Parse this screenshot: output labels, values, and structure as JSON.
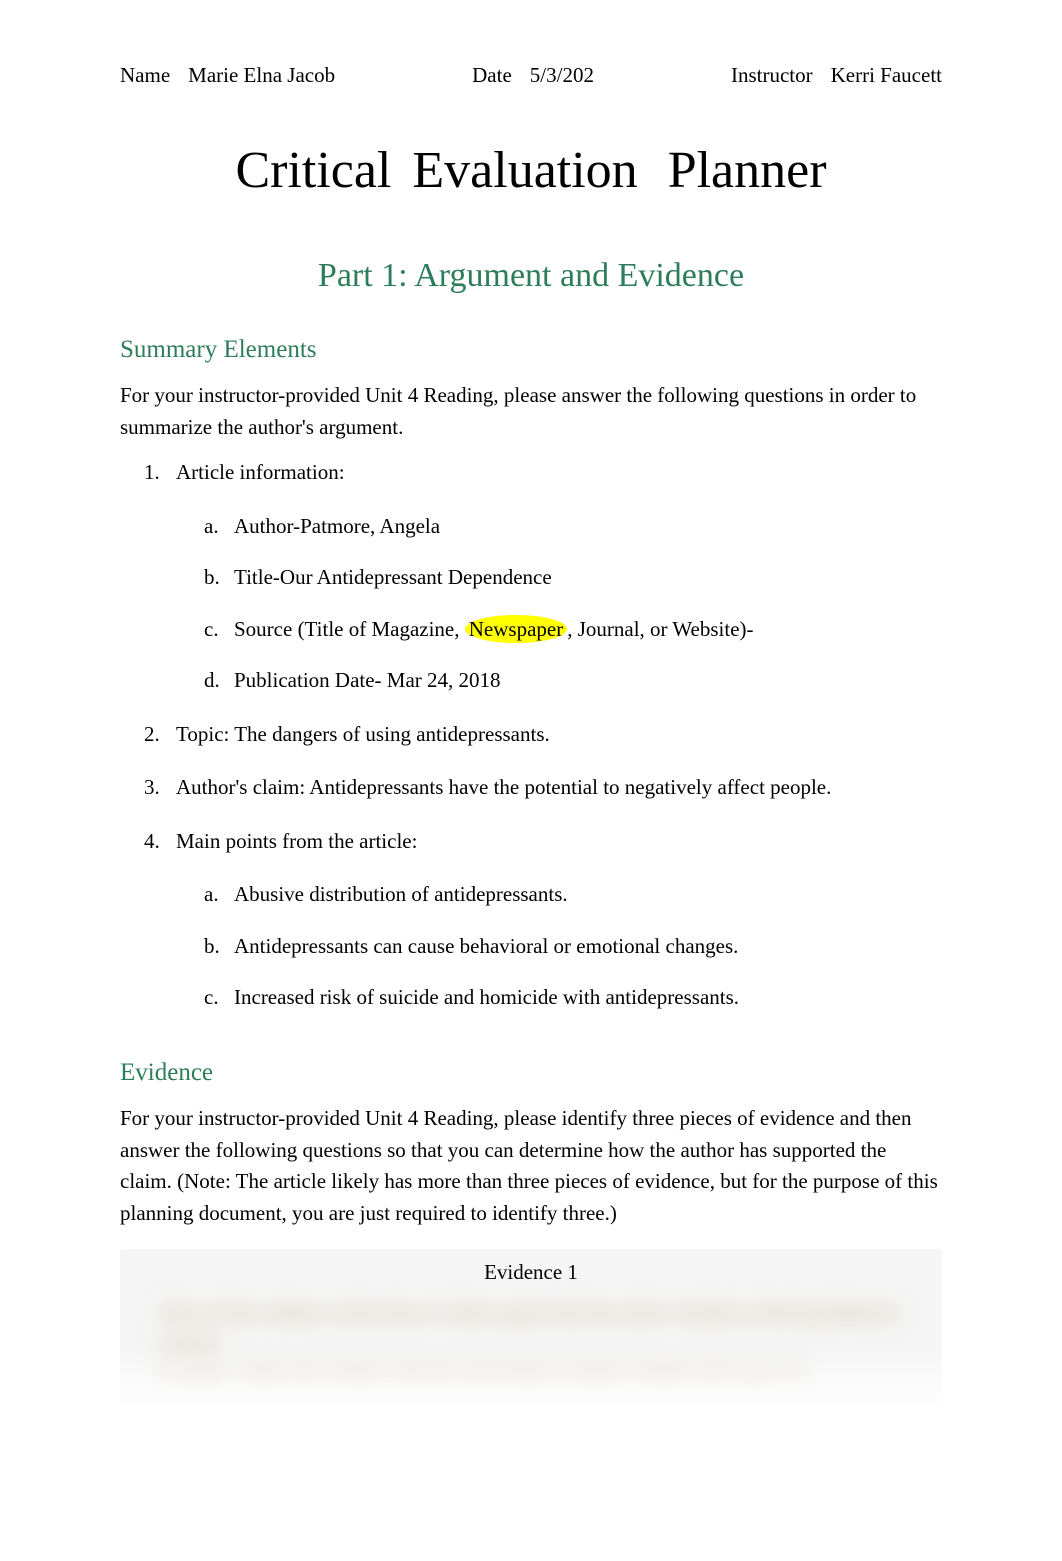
{
  "header": {
    "name_label": "Name",
    "name_value": "Marie Elna Jacob",
    "date_label": "Date",
    "date_value": "5/3/202",
    "instructor_label": "Instructor",
    "instructor_value": "Kerri Faucett"
  },
  "title_part1": "Critical Evaluation",
  "title_part2": "Planner",
  "part_title": "Part 1: Argument and Evidence",
  "summary": {
    "heading": "Summary Elements",
    "intro": "For your instructor-provided Unit 4 Reading, please answer the following questions in order to summarize the author's argument.",
    "items": {
      "article_info_label": "Article information:",
      "author_label": "Author-",
      "author_value": "Patmore, Angela",
      "title_label": "Title-",
      "title_value": "Our Antidepressant Dependence",
      "source_before": "Source (Title of Magazine, ",
      "source_highlight": "Newspaper",
      "source_after": ", Journal, or Website)-",
      "pubdate_label": "Publication Date- M",
      "pubdate_value": "ar 24, 2018",
      "topic_label": "Topic: ",
      "topic_value": "The dangers of using antidepressants.",
      "claim_label": "Author's claim: ",
      "claim_value": "Antidepressants have the potential to negatively affect people.",
      "mainpoints_label": "Main points from the article:",
      "point_a": "Abusive distribution of antidepressants.",
      "point_b": "Antidepressants can cause behavioral or emotional changes.",
      "point_c": "Increased risk of suicide and homicide with antidepressants."
    }
  },
  "evidence": {
    "heading": "Evidence",
    "intro": "For your instructor-provided Unit 4 Reading, please identify three pieces of evidence and then answer the following questions so that you can determine how the author has supported the claim. (Note: The article likely has more than three pieces of evidence, but for the purpose of this planning document, you are just required to identify three.)",
    "box_title": "Evidence 1",
    "blurred_line1": "Type out the evidence in the form of a direct quote from the article. Include an APA parenthetical citation.",
    "blurred_line2": "Example: \"Quote the evidence directly and include a citation\" (Smith, 2021, para. 3)."
  }
}
